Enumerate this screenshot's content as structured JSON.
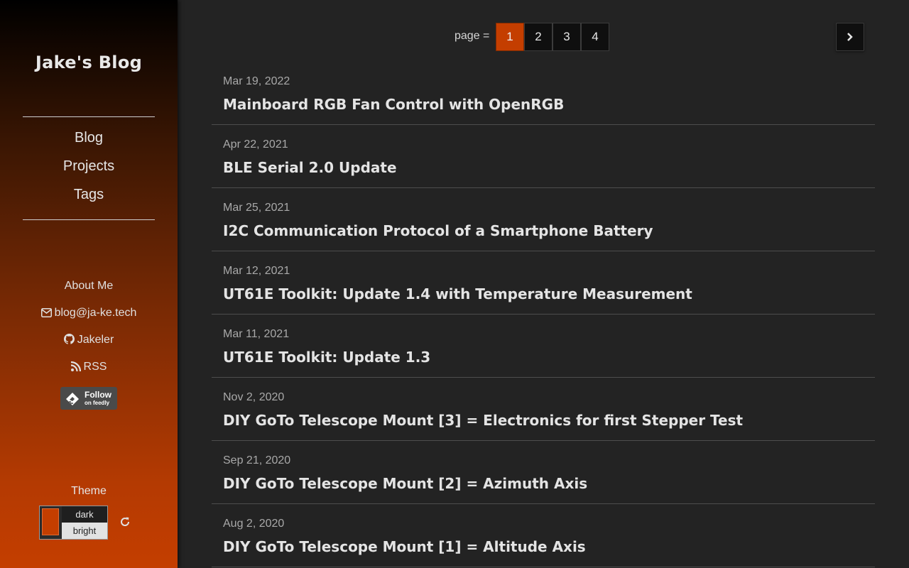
{
  "sidebar": {
    "title": "Jake's Blog",
    "nav": [
      {
        "label": "Blog"
      },
      {
        "label": "Projects"
      },
      {
        "label": "Tags"
      }
    ],
    "about_label": "About Me",
    "email": "blog@ja-ke.tech",
    "github": "Jakeler",
    "rss": "RSS",
    "feedly": {
      "line1": "Follow",
      "line2": "on feedly"
    },
    "theme": {
      "label": "Theme",
      "accent_color": "#c43e00",
      "options": [
        "dark",
        "bright"
      ],
      "selected": "dark"
    }
  },
  "pagination": {
    "label": "page =",
    "pages": [
      "1",
      "2",
      "3",
      "4"
    ],
    "current": "1"
  },
  "posts": [
    {
      "date": "Mar 19, 2022",
      "title": "Mainboard RGB Fan Control with OpenRGB"
    },
    {
      "date": "Apr 22, 2021",
      "title": "BLE Serial 2.0 Update"
    },
    {
      "date": "Mar 25, 2021",
      "title": "I2C Communication Protocol of a Smartphone Battery"
    },
    {
      "date": "Mar 12, 2021",
      "title": "UT61E Toolkit: Update 1.4 with Temperature Measurement"
    },
    {
      "date": "Mar 11, 2021",
      "title": "UT61E Toolkit: Update 1.3"
    },
    {
      "date": "Nov 2, 2020",
      "title": "DIY GoTo Telescope Mount [3] = Electronics for first Stepper Test"
    },
    {
      "date": "Sep 21, 2020",
      "title": "DIY GoTo Telescope Mount [2] = Azimuth Axis"
    },
    {
      "date": "Aug 2, 2020",
      "title": "DIY GoTo Telescope Mount [1] = Altitude Axis"
    }
  ]
}
